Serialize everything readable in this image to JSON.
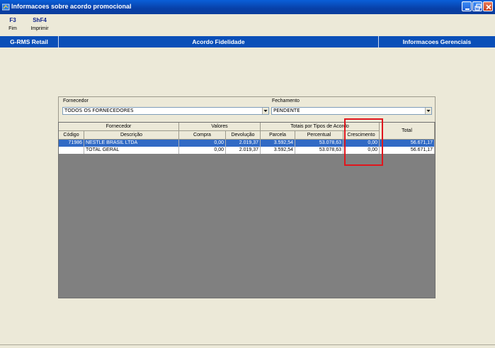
{
  "window": {
    "title": "Informacoes sobre acordo promocional",
    "icon": "app-icon"
  },
  "toolbar": {
    "items": [
      {
        "key": "F3",
        "label": "Fim"
      },
      {
        "key": "ShF4",
        "label": "Imprimir"
      }
    ]
  },
  "navbar": {
    "left": "G-RMS Retail",
    "center": "Acordo Fidelidade",
    "right": "Informacoes Gerenciais"
  },
  "filters": {
    "fornecedor_label": "Fornecedor",
    "fornecedor_value": "TODOS OS FORNECEDORES",
    "fechamento_label": "Fechamento",
    "fechamento_value": "PENDENTE"
  },
  "table": {
    "group_headers": {
      "fornecedor": "Fornecedor",
      "valores": "Valores",
      "totais": "Totais por Tipos de Acordo",
      "total": "Total"
    },
    "columns": {
      "codigo": "Código",
      "descricao": "Descrição",
      "compra": "Compra",
      "devolucao": "Devolução",
      "parcela": "Parcela",
      "percentual": "Percentual",
      "crescimento": "Crescimento"
    },
    "rows": [
      {
        "codigo": "71986",
        "descricao": "NESTLE BRASIL LTDA",
        "compra": "0,00",
        "devolucao": "2.019,37",
        "parcela": "3.592,54",
        "percentual": "53.078,63",
        "crescimento": "0,00",
        "total": "56.671,17"
      },
      {
        "codigo": "",
        "descricao": "TOTAL GERAL",
        "compra": "0,00",
        "devolucao": "2.019,37",
        "parcela": "3.592,54",
        "percentual": "53.078,63",
        "crescimento": "0,00",
        "total": "56.671,17"
      }
    ]
  },
  "colors": {
    "titlebar": "#0a5fd8",
    "navbar": "#0a4fb8",
    "selection": "#316ac5",
    "highlight_box": "#e0161d",
    "grid_background": "#808080"
  }
}
